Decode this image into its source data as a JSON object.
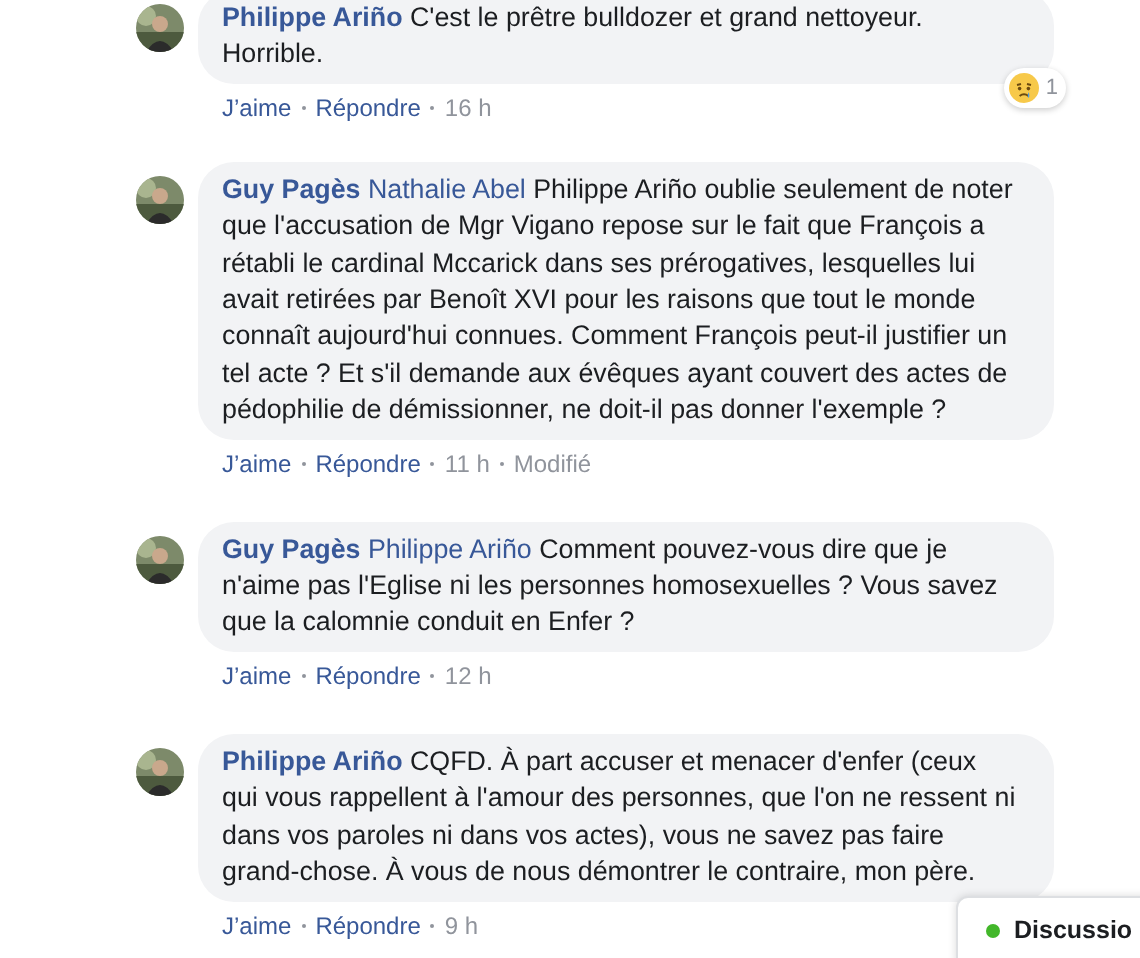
{
  "comments": [
    {
      "author": "Philippe Ariño",
      "text": "C'est le prêtre bulldozer et grand nettoyeur. Horrible.",
      "actions": [
        {
          "kind": "link",
          "label": "J’aime"
        },
        {
          "kind": "link",
          "label": "Répondre"
        },
        {
          "kind": "time",
          "label": "16 h"
        }
      ],
      "reaction": {
        "count": "1"
      }
    },
    {
      "author": "Guy Pagès",
      "mention": "Nathalie Abel",
      "text": "Philippe Ariño oublie seulement de noter que l'accusation de Mgr Vigano repose sur le fait que François a rétabli le cardinal Mccarick dans ses prérogatives, lesquelles lui avait retirées par Benoît XVI pour les raisons que tout le monde connaît aujourd'hui connues. Comment François peut-il justifier un tel acte ? Et s'il demande aux évêques ayant couvert des actes de pédophilie de démissionner, ne doit-il pas donner l'exemple ?",
      "actions": [
        {
          "kind": "link",
          "label": "J’aime"
        },
        {
          "kind": "link",
          "label": "Répondre"
        },
        {
          "kind": "time",
          "label": "11 h"
        },
        {
          "kind": "edited",
          "label": "Modifié"
        }
      ]
    },
    {
      "author": "Guy Pagès",
      "mention": "Philippe Ariño",
      "text": "Comment pouvez-vous dire que je n'aime pas l'Eglise ni les personnes homosexuelles ? Vous savez que la calomnie conduit en Enfer ?",
      "actions": [
        {
          "kind": "link",
          "label": "J’aime"
        },
        {
          "kind": "link",
          "label": "Répondre"
        },
        {
          "kind": "time",
          "label": "12 h"
        }
      ]
    },
    {
      "author": "Philippe Ariño",
      "text": "CQFD. À part accuser et menacer d'enfer (ceux qui vous rappellent à l'amour des personnes, que l'on ne ressent ni dans vos paroles ni dans vos actes), vous ne savez pas faire grand-chose. À vous de nous démontrer le contraire, mon père.",
      "actions": [
        {
          "kind": "link",
          "label": "J’aime"
        },
        {
          "kind": "link",
          "label": "Répondre"
        },
        {
          "kind": "time",
          "label": "9 h"
        }
      ]
    }
  ],
  "chat_tab": {
    "label": "Discussio",
    "online": true
  }
}
